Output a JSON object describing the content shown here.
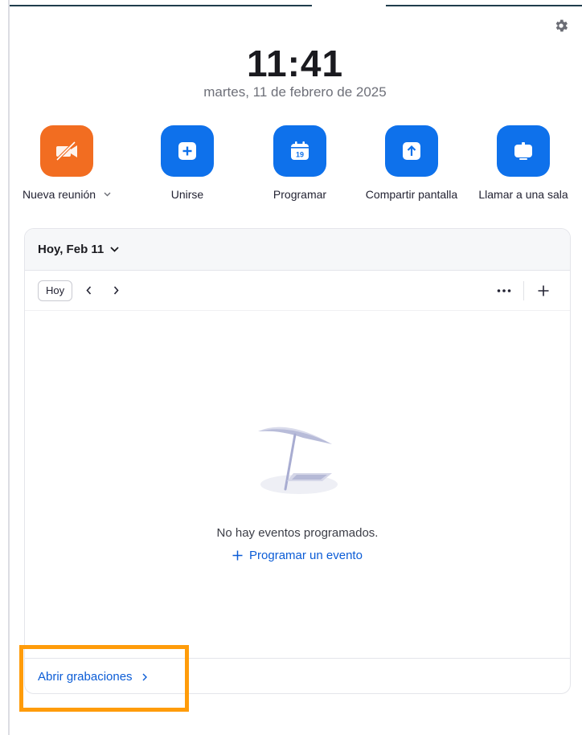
{
  "header": {
    "time": "11:41",
    "date": "martes, 11 de febrero de 2025"
  },
  "icons": {
    "settings": "gear-icon",
    "new_meeting": "video-off-icon",
    "join": "plus-icon",
    "schedule": "calendar-icon",
    "share": "share-screen-icon",
    "call_room": "room-display-icon"
  },
  "actions": {
    "new_meeting": {
      "label": "Nueva reunión",
      "color": "#f26d21"
    },
    "join": {
      "label": "Unirse",
      "color": "#0e71eb"
    },
    "schedule": {
      "label": "Programar",
      "calendar_day": "19",
      "color": "#0e71eb"
    },
    "share_screen": {
      "label": "Compartir pantalla",
      "color": "#0e71eb"
    },
    "call_room": {
      "label": "Llamar a una sala",
      "color": "#0e71eb"
    }
  },
  "calendar": {
    "day_label": "Hoy, Feb 11",
    "today_button": "Hoy",
    "empty_message": "No hay eventos programados.",
    "schedule_event_link": "Programar un evento"
  },
  "footer": {
    "recordings_link": "Abrir grabaciones"
  },
  "colors": {
    "accent_blue": "#0e71eb",
    "link_blue": "#0b5cd6",
    "highlight": "#ff9c0a"
  }
}
